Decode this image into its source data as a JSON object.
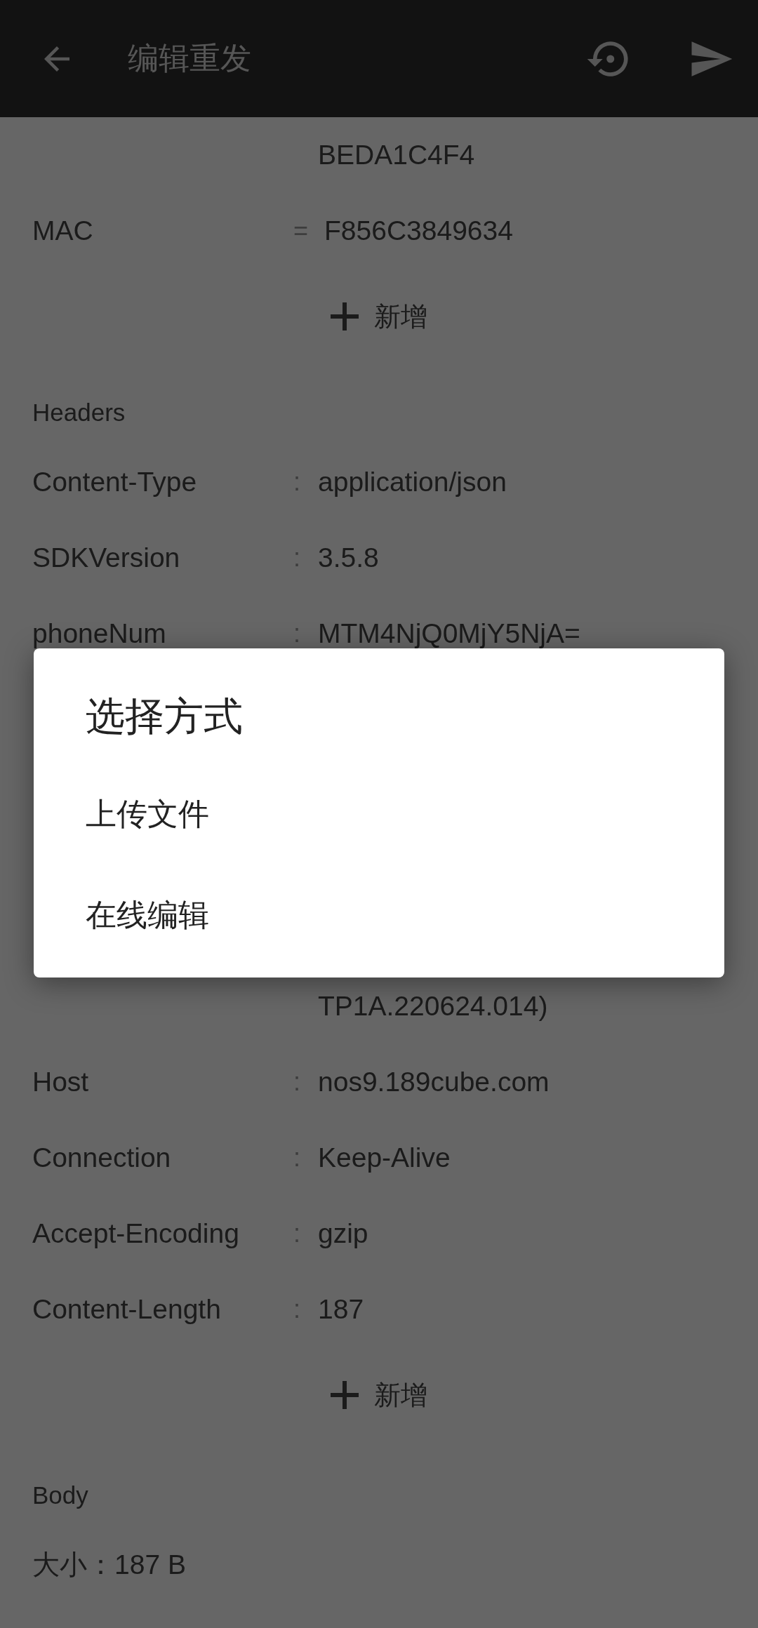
{
  "app_bar": {
    "title": "编辑重发"
  },
  "params": {
    "rows": [
      {
        "kind": "continuation",
        "value": "BEDA1C4F4"
      },
      {
        "kind": "pair",
        "key": "MAC",
        "separator": "=",
        "value": "F856C3849634"
      }
    ],
    "add_label": "新增"
  },
  "headers": {
    "title": "Headers",
    "rows": [
      {
        "kind": "pair",
        "key": "Content-Type",
        "separator": ":",
        "value": "application/json"
      },
      {
        "kind": "pair",
        "key": "SDKVersion",
        "separator": ":",
        "value": "3.5.8"
      },
      {
        "kind": "pair",
        "key": "phoneNum",
        "separator": ":",
        "value": "MTM4NjQ0MjY5NjA="
      },
      {
        "kind": "continuation",
        "value": "TP1A.220624.014)"
      },
      {
        "kind": "pair",
        "key": "Host",
        "separator": ":",
        "value": "nos9.189cube.com"
      },
      {
        "kind": "pair",
        "key": "Connection",
        "separator": ":",
        "value": "Keep-Alive"
      },
      {
        "kind": "pair",
        "key": "Accept-Encoding",
        "separator": ":",
        "value": "gzip"
      },
      {
        "kind": "pair",
        "key": "Content-Length",
        "separator": ":",
        "value": "187"
      }
    ],
    "add_label": "新增"
  },
  "body": {
    "title": "Body",
    "size": "大小：187 B"
  },
  "dialog": {
    "title": "选择方式",
    "options": [
      "上传文件",
      "在线编辑"
    ]
  }
}
